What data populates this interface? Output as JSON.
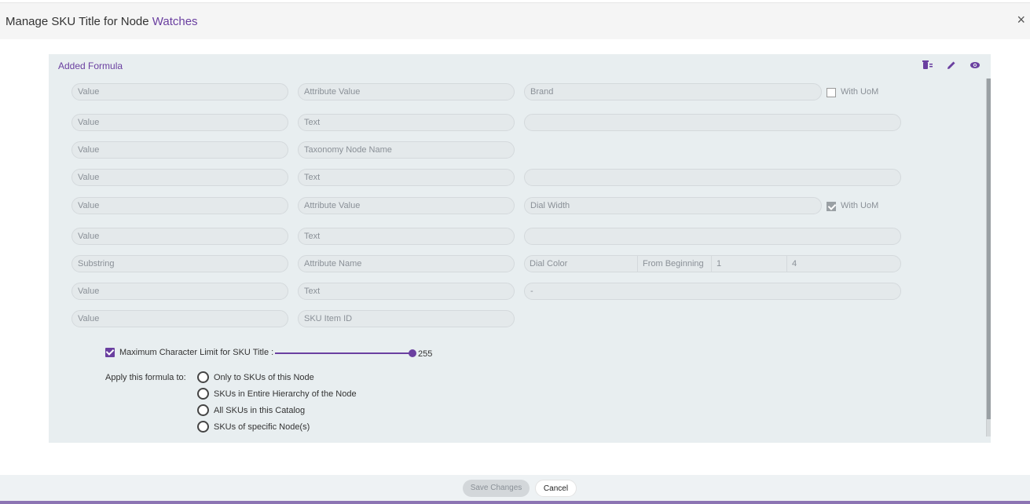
{
  "header": {
    "title_prefix": "Manage SKU Title for Node",
    "node_name": "Watches",
    "close_glyph": "×"
  },
  "panel": {
    "title": "Added Formula",
    "icons": [
      "delete-list-icon",
      "edit-pencil-icon",
      "view-eye-icon"
    ]
  },
  "rows": [
    {
      "type": "Value",
      "source": "Attribute Value",
      "value": "Brand",
      "with_uom": {
        "label": "With UoM",
        "checked": false
      }
    },
    {
      "type": "Value",
      "source": "Text",
      "value": ""
    },
    {
      "type": "Value",
      "source": "Taxonomy Node Name"
    },
    {
      "type": "Value",
      "source": "Text",
      "value": ""
    },
    {
      "type": "Value",
      "source": "Attribute Value",
      "value": "Dial Width",
      "with_uom": {
        "label": "With UoM",
        "checked": true
      }
    },
    {
      "type": "Value",
      "source": "Text",
      "value": ""
    },
    {
      "type": "Substring",
      "source": "Attribute Name",
      "value": "Dial Color",
      "position": "From Beginning",
      "start": "1",
      "length": "4"
    },
    {
      "type": "Value",
      "source": "Text",
      "value": "-"
    },
    {
      "type": "Value",
      "source": "SKU Item ID"
    }
  ],
  "limit": {
    "label": "Maximum Character Limit for SKU Title :",
    "checked": true,
    "value": "255",
    "fraction": 1.0
  },
  "apply": {
    "label": "Apply this formula to:",
    "options": [
      "Only to SKUs of this Node",
      "SKUs in Entire Hierarchy of the Node",
      "All SKUs in this Catalog",
      "SKUs of specific Node(s)"
    ]
  },
  "footer": {
    "save_label": "Save Changes",
    "cancel_label": "Cancel"
  },
  "colors": {
    "accent": "#6a3fa0",
    "panel_bg": "#e8eef0"
  }
}
